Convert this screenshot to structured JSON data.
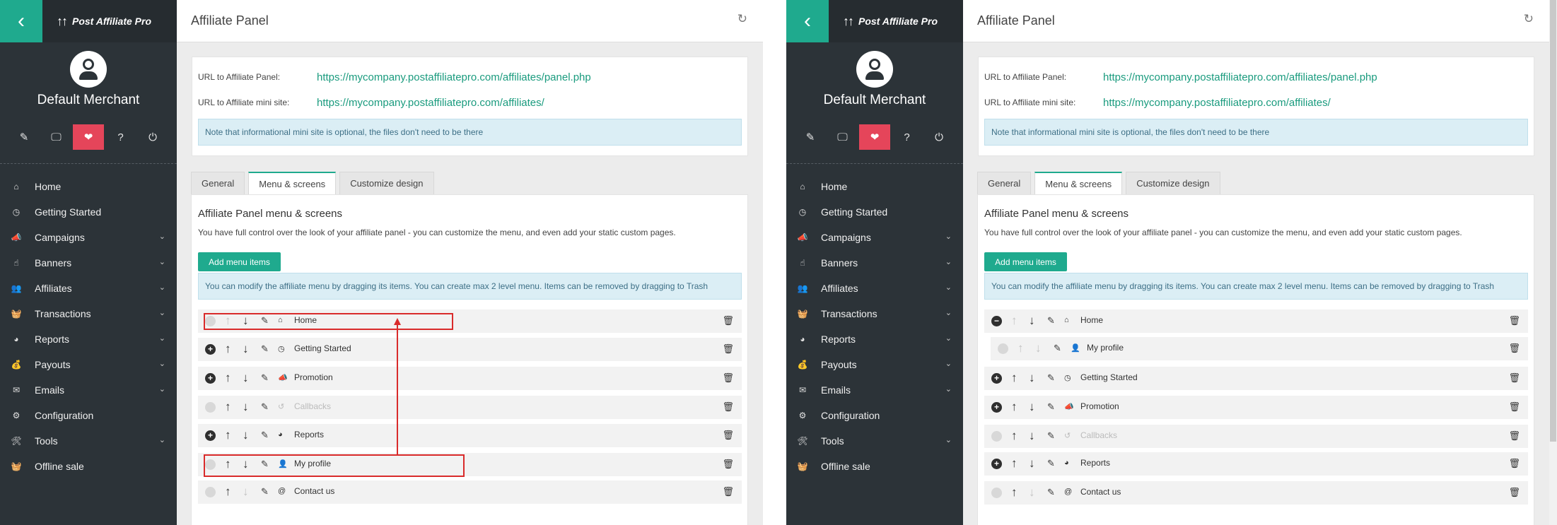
{
  "app": {
    "brand": "Post Affiliate Pro",
    "page_title": "Affiliate Panel",
    "merchant": "Default Merchant"
  },
  "sidebar": {
    "icons": [
      {
        "name": "pencil-icon",
        "glyph": "✎"
      },
      {
        "name": "monitor-icon",
        "glyph": "🖵"
      },
      {
        "name": "heartbeat-icon",
        "glyph": "❤"
      },
      {
        "name": "help-icon",
        "glyph": "?"
      },
      {
        "name": "power-icon",
        "glyph": "⏻"
      }
    ],
    "items": [
      {
        "label": "Home",
        "icon": "home-icon",
        "glyph": "⌂",
        "expandable": false
      },
      {
        "label": "Getting Started",
        "icon": "stopwatch-icon",
        "glyph": "◷",
        "expandable": false
      },
      {
        "label": "Campaigns",
        "icon": "bullhorn-icon",
        "glyph": "📣",
        "expandable": true
      },
      {
        "label": "Banners",
        "icon": "hand-pointer-icon",
        "glyph": "☝",
        "expandable": true
      },
      {
        "label": "Affiliates",
        "icon": "users-icon",
        "glyph": "👥",
        "expandable": true
      },
      {
        "label": "Transactions",
        "icon": "basket-icon",
        "glyph": "🧺",
        "expandable": true
      },
      {
        "label": "Reports",
        "icon": "pie-chart-icon",
        "glyph": "◕",
        "expandable": true
      },
      {
        "label": "Payouts",
        "icon": "money-bag-icon",
        "glyph": "💰",
        "expandable": true
      },
      {
        "label": "Emails",
        "icon": "envelope-icon",
        "glyph": "✉",
        "expandable": true
      },
      {
        "label": "Configuration",
        "icon": "gear-icon",
        "glyph": "⚙",
        "expandable": false
      },
      {
        "label": "Tools",
        "icon": "tools-icon",
        "glyph": "🛠",
        "expandable": true
      },
      {
        "label": "Offline sale",
        "icon": "basket-icon",
        "glyph": "🧺",
        "expandable": false
      }
    ]
  },
  "urls": {
    "panel_label": "URL to Affiliate Panel:",
    "panel_url": "https://mycompany.postaffiliatepro.com/affiliates/panel.php",
    "mini_label": "URL to Affiliate mini site:",
    "mini_url": "https://mycompany.postaffiliatepro.com/affiliates/",
    "note": "Note that informational mini site is optional, the files don't need to be there"
  },
  "tabs": [
    "General",
    "Menu & screens",
    "Customize design"
  ],
  "active_tab": "Menu & screens",
  "section": {
    "title": "Affiliate Panel menu & screens",
    "description": "You have full control over the look of your affiliate panel - you can customize the menu, and even add your static custom pages.",
    "add_button": "Add menu items",
    "info": "You can modify the affiliate menu by dragging its items. You can create max 2 level menu. Items can be removed by dragging to Trash"
  },
  "menu_before": [
    {
      "label": "Home",
      "icon": "home-icon",
      "glyph": "⌂",
      "toggle": "none",
      "up_disabled": true,
      "down_disabled": false,
      "disabled": false,
      "child": false
    },
    {
      "label": "Getting Started",
      "icon": "stopwatch-icon",
      "glyph": "◷",
      "toggle": "plus",
      "up_disabled": false,
      "down_disabled": false,
      "disabled": false,
      "child": false
    },
    {
      "label": "Promotion",
      "icon": "bullhorn-icon",
      "glyph": "📣",
      "toggle": "plus",
      "up_disabled": false,
      "down_disabled": false,
      "disabled": false,
      "child": false
    },
    {
      "label": "Callbacks",
      "icon": "callback-icon",
      "glyph": "↺",
      "toggle": "none",
      "up_disabled": false,
      "down_disabled": false,
      "disabled": true,
      "child": false
    },
    {
      "label": "Reports",
      "icon": "pie-chart-icon",
      "glyph": "◕",
      "toggle": "plus",
      "up_disabled": false,
      "down_disabled": false,
      "disabled": false,
      "child": false
    },
    {
      "label": "My profile",
      "icon": "user-icon",
      "glyph": "👤",
      "toggle": "none",
      "up_disabled": false,
      "down_disabled": false,
      "disabled": false,
      "child": false
    },
    {
      "label": "Contact us",
      "icon": "at-icon",
      "glyph": "@",
      "toggle": "none",
      "up_disabled": false,
      "down_disabled": true,
      "disabled": false,
      "child": false
    }
  ],
  "menu_after": [
    {
      "label": "Home",
      "icon": "home-icon",
      "glyph": "⌂",
      "toggle": "minus",
      "up_disabled": true,
      "down_disabled": false,
      "disabled": false,
      "child": false
    },
    {
      "label": "My profile",
      "icon": "user-icon",
      "glyph": "👤",
      "toggle": "none",
      "up_disabled": true,
      "down_disabled": true,
      "disabled": false,
      "child": true
    },
    {
      "label": "Getting Started",
      "icon": "stopwatch-icon",
      "glyph": "◷",
      "toggle": "plus",
      "up_disabled": false,
      "down_disabled": false,
      "disabled": false,
      "child": false
    },
    {
      "label": "Promotion",
      "icon": "bullhorn-icon",
      "glyph": "📣",
      "toggle": "plus",
      "up_disabled": false,
      "down_disabled": false,
      "disabled": false,
      "child": false
    },
    {
      "label": "Callbacks",
      "icon": "callback-icon",
      "glyph": "↺",
      "toggle": "none",
      "up_disabled": false,
      "down_disabled": false,
      "disabled": true,
      "child": false
    },
    {
      "label": "Reports",
      "icon": "pie-chart-icon",
      "glyph": "◕",
      "toggle": "plus",
      "up_disabled": false,
      "down_disabled": false,
      "disabled": false,
      "child": false
    },
    {
      "label": "Contact us",
      "icon": "at-icon",
      "glyph": "@",
      "toggle": "none",
      "up_disabled": false,
      "down_disabled": true,
      "disabled": false,
      "child": false
    }
  ],
  "colors": {
    "accent": "#1faa8e",
    "sidebar": "#2c3338",
    "active_icon": "#e5455a",
    "annotation": "#d92b2b"
  }
}
